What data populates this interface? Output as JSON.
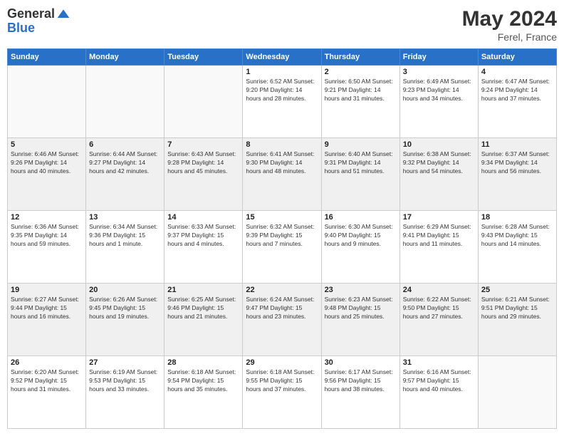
{
  "header": {
    "logo_general": "General",
    "logo_blue": "Blue",
    "month_title": "May 2024",
    "location": "Ferel, France"
  },
  "weekdays": [
    "Sunday",
    "Monday",
    "Tuesday",
    "Wednesday",
    "Thursday",
    "Friday",
    "Saturday"
  ],
  "weeks": [
    [
      {
        "day": "",
        "info": ""
      },
      {
        "day": "",
        "info": ""
      },
      {
        "day": "",
        "info": ""
      },
      {
        "day": "1",
        "info": "Sunrise: 6:52 AM\nSunset: 9:20 PM\nDaylight: 14 hours and 28 minutes."
      },
      {
        "day": "2",
        "info": "Sunrise: 6:50 AM\nSunset: 9:21 PM\nDaylight: 14 hours and 31 minutes."
      },
      {
        "day": "3",
        "info": "Sunrise: 6:49 AM\nSunset: 9:23 PM\nDaylight: 14 hours and 34 minutes."
      },
      {
        "day": "4",
        "info": "Sunrise: 6:47 AM\nSunset: 9:24 PM\nDaylight: 14 hours and 37 minutes."
      }
    ],
    [
      {
        "day": "5",
        "info": "Sunrise: 6:46 AM\nSunset: 9:26 PM\nDaylight: 14 hours and 40 minutes."
      },
      {
        "day": "6",
        "info": "Sunrise: 6:44 AM\nSunset: 9:27 PM\nDaylight: 14 hours and 42 minutes."
      },
      {
        "day": "7",
        "info": "Sunrise: 6:43 AM\nSunset: 9:28 PM\nDaylight: 14 hours and 45 minutes."
      },
      {
        "day": "8",
        "info": "Sunrise: 6:41 AM\nSunset: 9:30 PM\nDaylight: 14 hours and 48 minutes."
      },
      {
        "day": "9",
        "info": "Sunrise: 6:40 AM\nSunset: 9:31 PM\nDaylight: 14 hours and 51 minutes."
      },
      {
        "day": "10",
        "info": "Sunrise: 6:38 AM\nSunset: 9:32 PM\nDaylight: 14 hours and 54 minutes."
      },
      {
        "day": "11",
        "info": "Sunrise: 6:37 AM\nSunset: 9:34 PM\nDaylight: 14 hours and 56 minutes."
      }
    ],
    [
      {
        "day": "12",
        "info": "Sunrise: 6:36 AM\nSunset: 9:35 PM\nDaylight: 14 hours and 59 minutes."
      },
      {
        "day": "13",
        "info": "Sunrise: 6:34 AM\nSunset: 9:36 PM\nDaylight: 15 hours and 1 minute."
      },
      {
        "day": "14",
        "info": "Sunrise: 6:33 AM\nSunset: 9:37 PM\nDaylight: 15 hours and 4 minutes."
      },
      {
        "day": "15",
        "info": "Sunrise: 6:32 AM\nSunset: 9:39 PM\nDaylight: 15 hours and 7 minutes."
      },
      {
        "day": "16",
        "info": "Sunrise: 6:30 AM\nSunset: 9:40 PM\nDaylight: 15 hours and 9 minutes."
      },
      {
        "day": "17",
        "info": "Sunrise: 6:29 AM\nSunset: 9:41 PM\nDaylight: 15 hours and 11 minutes."
      },
      {
        "day": "18",
        "info": "Sunrise: 6:28 AM\nSunset: 9:43 PM\nDaylight: 15 hours and 14 minutes."
      }
    ],
    [
      {
        "day": "19",
        "info": "Sunrise: 6:27 AM\nSunset: 9:44 PM\nDaylight: 15 hours and 16 minutes."
      },
      {
        "day": "20",
        "info": "Sunrise: 6:26 AM\nSunset: 9:45 PM\nDaylight: 15 hours and 19 minutes."
      },
      {
        "day": "21",
        "info": "Sunrise: 6:25 AM\nSunset: 9:46 PM\nDaylight: 15 hours and 21 minutes."
      },
      {
        "day": "22",
        "info": "Sunrise: 6:24 AM\nSunset: 9:47 PM\nDaylight: 15 hours and 23 minutes."
      },
      {
        "day": "23",
        "info": "Sunrise: 6:23 AM\nSunset: 9:48 PM\nDaylight: 15 hours and 25 minutes."
      },
      {
        "day": "24",
        "info": "Sunrise: 6:22 AM\nSunset: 9:50 PM\nDaylight: 15 hours and 27 minutes."
      },
      {
        "day": "25",
        "info": "Sunrise: 6:21 AM\nSunset: 9:51 PM\nDaylight: 15 hours and 29 minutes."
      }
    ],
    [
      {
        "day": "26",
        "info": "Sunrise: 6:20 AM\nSunset: 9:52 PM\nDaylight: 15 hours and 31 minutes."
      },
      {
        "day": "27",
        "info": "Sunrise: 6:19 AM\nSunset: 9:53 PM\nDaylight: 15 hours and 33 minutes."
      },
      {
        "day": "28",
        "info": "Sunrise: 6:18 AM\nSunset: 9:54 PM\nDaylight: 15 hours and 35 minutes."
      },
      {
        "day": "29",
        "info": "Sunrise: 6:18 AM\nSunset: 9:55 PM\nDaylight: 15 hours and 37 minutes."
      },
      {
        "day": "30",
        "info": "Sunrise: 6:17 AM\nSunset: 9:56 PM\nDaylight: 15 hours and 38 minutes."
      },
      {
        "day": "31",
        "info": "Sunrise: 6:16 AM\nSunset: 9:57 PM\nDaylight: 15 hours and 40 minutes."
      },
      {
        "day": "",
        "info": ""
      }
    ]
  ]
}
